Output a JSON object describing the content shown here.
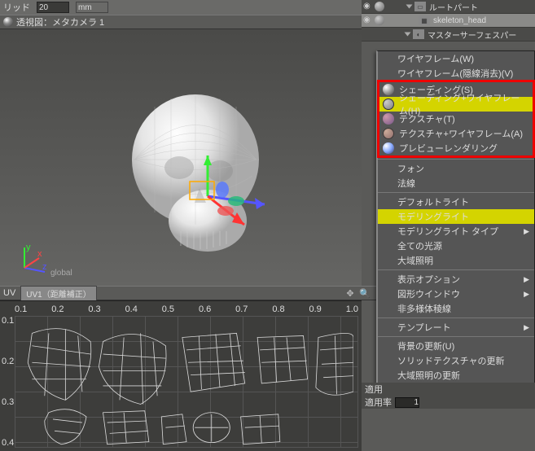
{
  "topbar": {
    "grid_label": "リッド",
    "grid_value": "20",
    "unit": "mm"
  },
  "viewport": {
    "title": "透視図：メタカメラ 1",
    "global": "global"
  },
  "uv": {
    "label": "UV",
    "mode": "UV1（距離補正）",
    "ticks_x": [
      "0.1",
      "0.2",
      "0.3",
      "0.4",
      "0.5",
      "0.6",
      "0.7",
      "0.8",
      "0.9",
      "1.0"
    ],
    "ticks_y": [
      "0.1",
      "0.2",
      "0.3",
      "0.4"
    ]
  },
  "tree": {
    "items": [
      {
        "label": "ルートパート"
      },
      {
        "label": "skeleton_head"
      },
      {
        "label": "マスターサーフェスパー"
      }
    ]
  },
  "menu": {
    "wire": "ワイヤフレーム(W)",
    "wire2": "ワイヤフレーム(隠線消去)(V)",
    "shade": "シェーディング(S)",
    "shadewire": "シェーディング+ワイヤフレーム(H)",
    "tex": "テクスチャ(T)",
    "texwire": "テクスチャ+ワイヤフレーム(A)",
    "preview": "プレビューレンダリング",
    "phong": "フォン",
    "normal": "法線",
    "deflight": "デフォルトライト",
    "modlight": "モデリングライト",
    "modlighttype": "モデリングライト タイプ",
    "alllights": "全ての光源",
    "globalillum": "大域照明",
    "dispopt": "表示オプション",
    "shapewin": "図形ウインドウ",
    "nonmanifold": "非多様体稜線",
    "template": "テンプレート",
    "bgupdate": "背景の更新(U)",
    "solidtex": "ソリッドテクスチャの更新",
    "giupdate": "大域照明の更新"
  },
  "props": {
    "label1": "適用",
    "label2": "適用率",
    "val": "1"
  }
}
